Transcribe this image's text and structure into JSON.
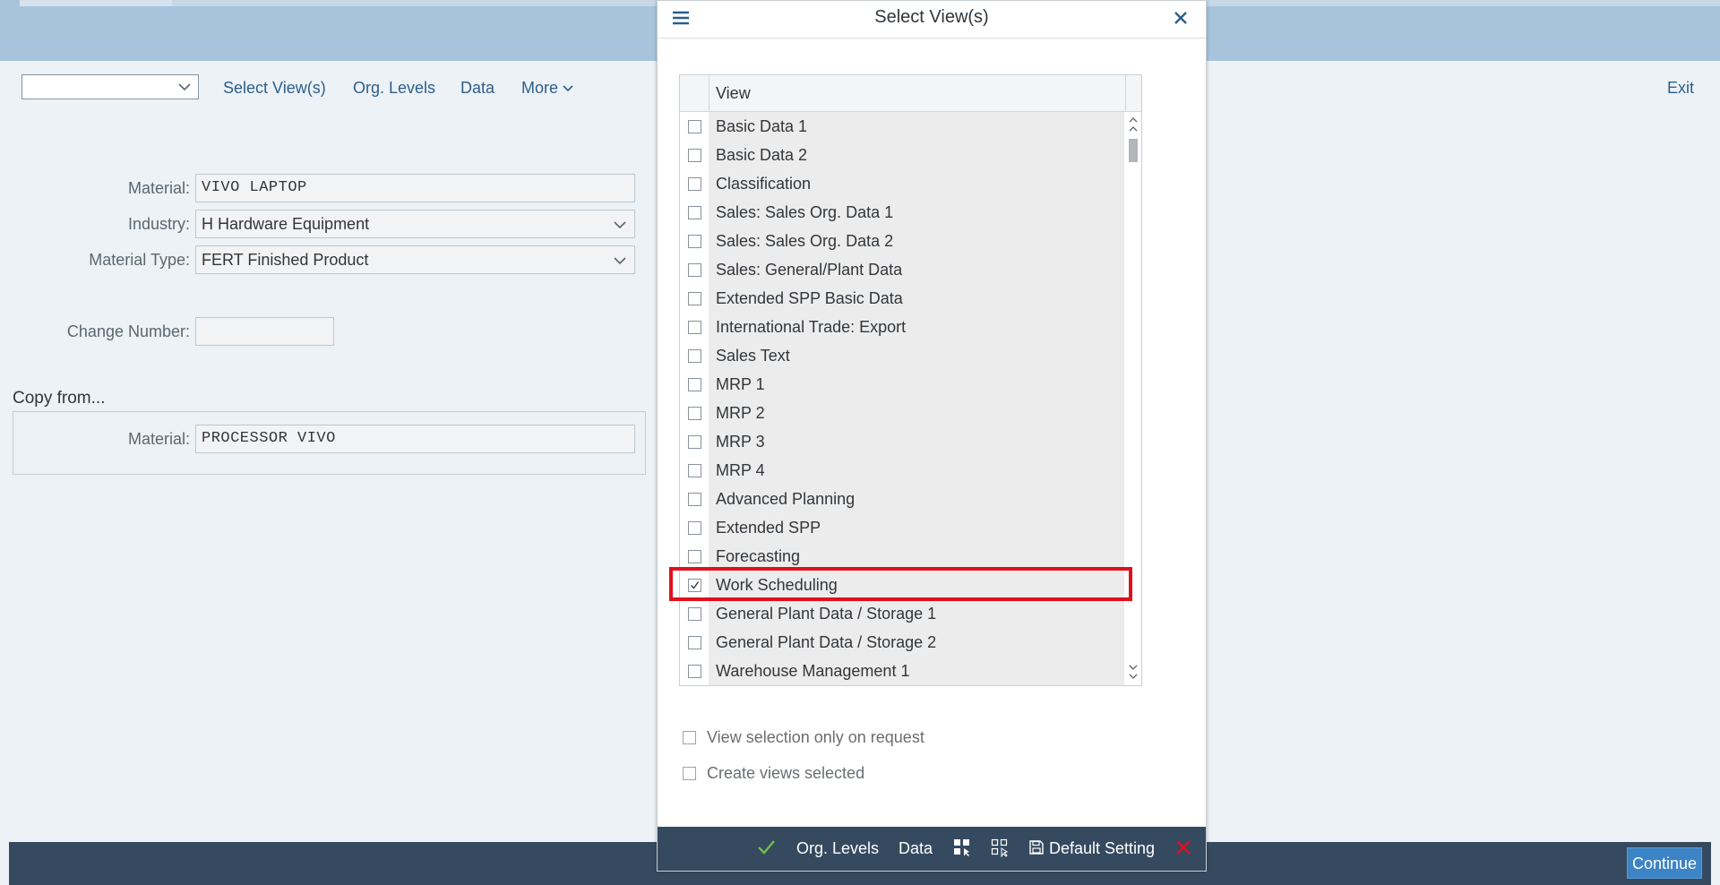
{
  "toolbar": {
    "select_value": "",
    "select_views": "Select View(s)",
    "org_levels": "Org. Levels",
    "data": "Data",
    "more": "More",
    "exit": "Exit"
  },
  "form": {
    "material_label": "Material:",
    "material_value": "VIVO LAPTOP",
    "industry_label": "Industry:",
    "industry_value": "H Hardware Equipment",
    "material_type_label": "Material Type:",
    "material_type_value": "FERT Finished Product",
    "change_number_label": "Change Number:",
    "change_number_value": "",
    "copy_from_title": "Copy from...",
    "copy_material_label": "Material:",
    "copy_material_value": "PROCESSOR VIVO"
  },
  "footer": {
    "continue": "Continue"
  },
  "dialog": {
    "title": "Select View(s)",
    "column_header": "View",
    "views": [
      {
        "label": "Basic Data 1",
        "checked": false
      },
      {
        "label": "Basic Data 2",
        "checked": false
      },
      {
        "label": "Classification",
        "checked": false
      },
      {
        "label": "Sales: Sales Org. Data 1",
        "checked": false
      },
      {
        "label": "Sales: Sales Org. Data 2",
        "checked": false
      },
      {
        "label": "Sales: General/Plant Data",
        "checked": false
      },
      {
        "label": "Extended SPP Basic Data",
        "checked": false
      },
      {
        "label": "International Trade: Export",
        "checked": false
      },
      {
        "label": "Sales Text",
        "checked": false
      },
      {
        "label": "MRP 1",
        "checked": false
      },
      {
        "label": "MRP 2",
        "checked": false
      },
      {
        "label": "MRP 3",
        "checked": false
      },
      {
        "label": "MRP 4",
        "checked": false
      },
      {
        "label": "Advanced Planning",
        "checked": false
      },
      {
        "label": "Extended SPP",
        "checked": false
      },
      {
        "label": "Forecasting",
        "checked": false
      },
      {
        "label": "Work Scheduling",
        "checked": true
      },
      {
        "label": "General Plant Data / Storage 1",
        "checked": false
      },
      {
        "label": "General Plant Data / Storage 2",
        "checked": false
      },
      {
        "label": "Warehouse Management 1",
        "checked": false
      }
    ],
    "option_view_on_request": "View selection only on request",
    "option_create_views": "Create views selected",
    "footer": {
      "org_levels": "Org. Levels",
      "data": "Data",
      "default_setting": "Default Setting"
    },
    "colors": {
      "highlight": "#e0101c",
      "confirm": "#6cc04a",
      "cancel": "#e0101c",
      "footer_bg": "#354a5f"
    }
  }
}
